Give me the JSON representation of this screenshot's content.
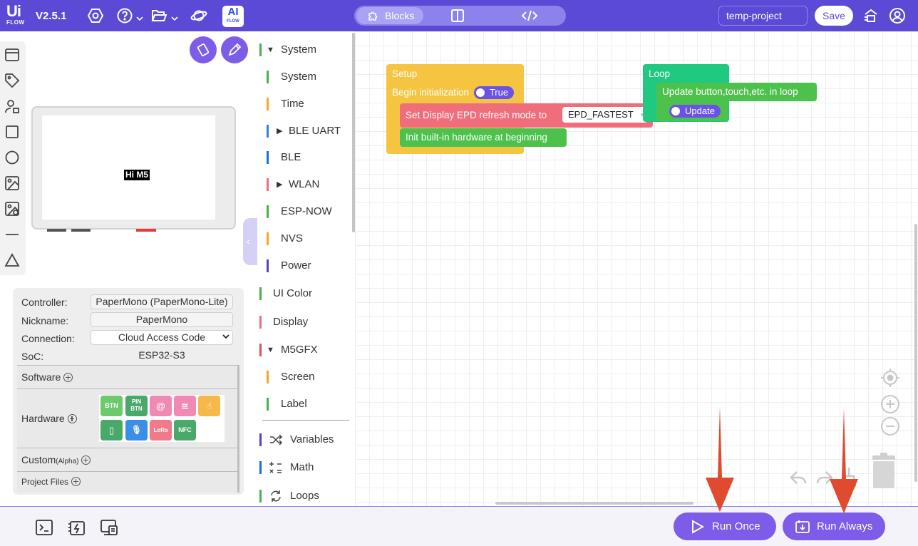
{
  "app": {
    "logo_top": "Ui",
    "logo_bottom": "FLOW",
    "version": "V2.5.1",
    "ai_label_top": "AI",
    "ai_label_bottom": "FLOW"
  },
  "view_switch": {
    "blocks_label": "Blocks"
  },
  "header": {
    "project_name": "temp-project",
    "save_label": "Save"
  },
  "device_screen": {
    "text": "Hi M5"
  },
  "info": {
    "controller_label": "Controller:",
    "controller_value": "PaperMono (PaperMono-Lite)",
    "nickname_label": "Nickname:",
    "nickname_value": "PaperMono",
    "connection_label": "Connection:",
    "connection_value": "Cloud Access Code",
    "soc_label": "SoC:",
    "soc_value": "ESP32-S3",
    "software_label": "Software",
    "hardware_label": "Hardware",
    "custom_label": "Custom",
    "custom_suffix": "(Alpha)",
    "project_files_label": "Project Files",
    "hardware_chips": [
      {
        "label": "BTN",
        "color": "#6cc96c"
      },
      {
        "label": "PIN\nBTN",
        "color": "#4aa86a"
      },
      {
        "label": "@",
        "color": "#f08ab5"
      },
      {
        "label": "≋",
        "color": "#f08ab5"
      },
      {
        "label": "☝",
        "color": "#f5b84a"
      },
      {
        "label": "▯",
        "color": "#4aa86a"
      },
      {
        "label": "🎙",
        "color": "#3b8fe8"
      },
      {
        "label": "LoRa",
        "color": "#f07a8a"
      },
      {
        "label": "NFC",
        "color": "#4aa86a"
      }
    ]
  },
  "categories": [
    {
      "label": "System",
      "color": "#4caf50",
      "expanded": true,
      "indent": 0
    },
    {
      "label": "System",
      "color": "#4caf50",
      "indent": 1
    },
    {
      "label": "Time",
      "color": "#f5a623",
      "indent": 1
    },
    {
      "label": "BLE UART",
      "color": "#3b7dd8",
      "collapsed": true,
      "indent": 1
    },
    {
      "label": "BLE",
      "color": "#1a6fd4",
      "indent": 1
    },
    {
      "label": "WLAN",
      "color": "#f06d7c",
      "collapsed": true,
      "indent": 1
    },
    {
      "label": "ESP-NOW",
      "color": "#4caf50",
      "indent": 1
    },
    {
      "label": "NVS",
      "color": "#f5a623",
      "indent": 1
    },
    {
      "label": "Power",
      "color": "#5b3fc9",
      "indent": 1
    },
    {
      "label": "UI Color",
      "color": "#4caf50",
      "indent": 0
    },
    {
      "label": "Display",
      "color": "#f06d7c",
      "indent": 0
    },
    {
      "label": "M5GFX",
      "color": "#e0505e",
      "expanded": true,
      "indent": 0
    },
    {
      "label": "Screen",
      "color": "#f5a623",
      "indent": 1
    },
    {
      "label": "Label",
      "color": "#4caf50",
      "indent": 1
    },
    {
      "label": "Variables",
      "color": "#5b3fc9",
      "icon": "shuffle-icon",
      "indent": 0
    },
    {
      "label": "Math",
      "color": "#1a6fd4",
      "icon": "math-icon",
      "indent": 0
    },
    {
      "label": "Loops",
      "color": "#4caf50",
      "icon": "loop-icon",
      "indent": 0
    }
  ],
  "blocks": {
    "setup_label": "Setup",
    "begin_init_label": "Begin initialization",
    "begin_init_value": "True",
    "set_display_label": "Set Display EPD refresh mode to",
    "set_display_value": "EPD_FASTEST",
    "init_hw_label": "Init built-in hardware at beginning",
    "loop_label": "Loop",
    "update_label": "Update button,touch,etc. in loop",
    "update_toggle": "Update"
  },
  "bottom": {
    "run_once_label": "Run Once",
    "run_always_label": "Run Always"
  },
  "colors": {
    "brand": "#5b4ad6",
    "setup_block": "#f5c542",
    "loop_block": "#1fc97f",
    "display_block": "#f06d7c",
    "init_block": "#4cc24c",
    "toggle": "#6a52e8",
    "annotation_arrow": "#e04a2e"
  }
}
